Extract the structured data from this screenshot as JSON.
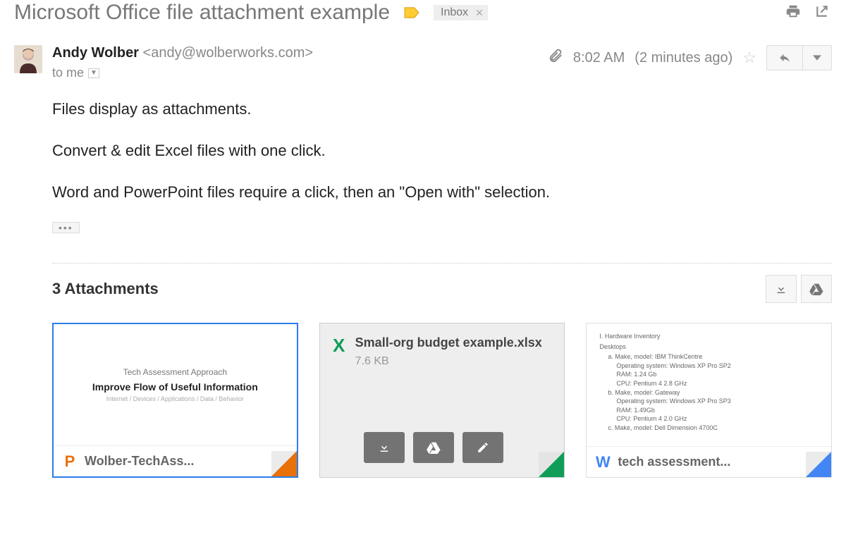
{
  "header": {
    "subject": "Microsoft Office file attachment example",
    "inbox_label": "Inbox"
  },
  "sender": {
    "name": "Andy Wolber",
    "email": "<andy@wolberworks.com>",
    "to_text": "to me",
    "time": "8:02 AM",
    "ago": "(2 minutes ago)"
  },
  "body": {
    "p1": "Files display as attachments.",
    "p2": "Convert & edit Excel files with one click.",
    "p3": "Word and PowerPoint files require a click, then an \"Open with\" selection."
  },
  "attachments": {
    "title": "3 Attachments",
    "cards": [
      {
        "icon_letter": "P",
        "display_name": "Wolber-TechAss...",
        "preview_title": "Tech Assessment Approach",
        "preview_subtitle": "Improve Flow of Useful Information",
        "preview_meta": "Internet / Devices / Applications / Data / Behavior"
      },
      {
        "icon_letter": "X",
        "display_name": "Small-org budget example.xlsx",
        "file_size": "7.6 KB"
      },
      {
        "icon_letter": "W",
        "display_name": "tech assessment...",
        "doc_lines": {
          "l0": "I.  Hardware Inventory",
          "l1": "Desktops",
          "l2": "a. Make, model: IBM ThinkCentre",
          "l3": "Operating system: Windows XP Pro SP2",
          "l4": "RAM: 1.24 Gb",
          "l5": "CPU: Pentium 4   2.8 GHz",
          "l6": "b. Make, model: Gateway",
          "l7": "Operating system: Windows XP Pro SP3",
          "l8": "RAM: 1.49Gb",
          "l9": "CPU: Pentium 4   2.0 GHz",
          "l10": "c. Make, model: Dell Dimension 4700C"
        }
      }
    ]
  }
}
